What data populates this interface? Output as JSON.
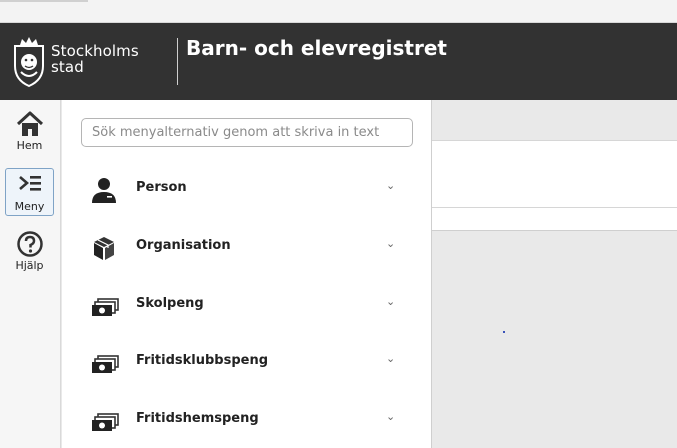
{
  "header": {
    "logo_line1": "Stockholms",
    "logo_line2": "stad",
    "app_title": "Barn- och elevregistret"
  },
  "rail": {
    "items": [
      {
        "label": "Hem",
        "icon": "home-icon"
      },
      {
        "label": "Meny",
        "icon": "menu-icon",
        "active": true
      },
      {
        "label": "Hjälp",
        "icon": "help-icon"
      }
    ]
  },
  "menu": {
    "search_placeholder": "Sök menyalternativ genom att skriva in text",
    "items": [
      {
        "label": "Person",
        "icon": "person-icon"
      },
      {
        "label": "Organisation",
        "icon": "box-icon"
      },
      {
        "label": "Skolpeng",
        "icon": "money-icon"
      },
      {
        "label": "Fritidsklubbspeng",
        "icon": "money-icon"
      },
      {
        "label": "Fritidshemspeng",
        "icon": "money-icon"
      }
    ],
    "chevron": "⌄"
  },
  "colors": {
    "header_bg": "#323232",
    "active_border": "#7fa3c6"
  }
}
